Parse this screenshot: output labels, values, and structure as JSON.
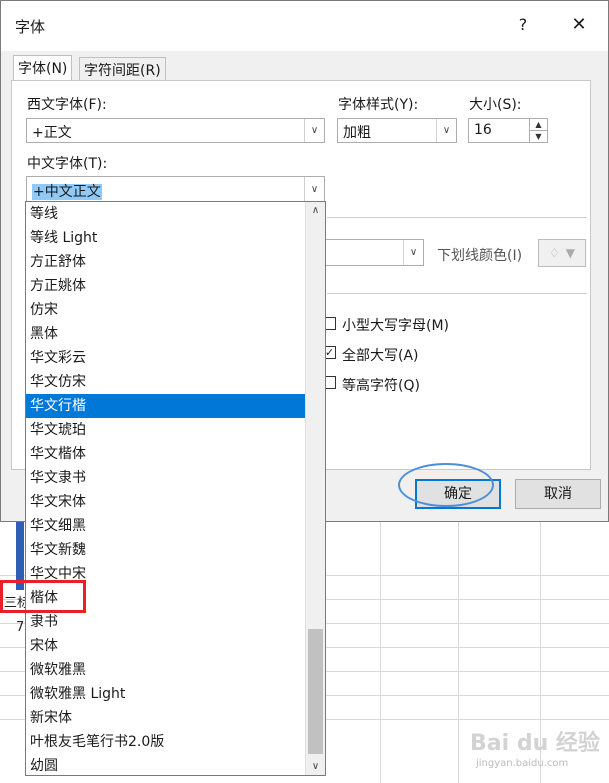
{
  "dialog": {
    "title": "字体",
    "help_label": "?",
    "close_label": "✕",
    "tabs": [
      {
        "label": "字体(N)"
      },
      {
        "label": "字符间距(R)"
      }
    ],
    "western_font_label": "西文字体(F):",
    "western_font_value": "+正文",
    "font_style_label": "字体样式(Y):",
    "font_style_value": "加粗",
    "size_label": "大小(S):",
    "size_value": "16",
    "chinese_font_label": "中文字体(T):",
    "chinese_font_value": "+中文正文",
    "underline_color_label": "下划线颜色(I)",
    "effects": [
      {
        "label": "小型大写字母(M)",
        "checked": false
      },
      {
        "label": "全部大写(A)",
        "checked": true
      },
      {
        "label": "等高字符(Q)",
        "checked": false
      }
    ],
    "ok_label": "确定",
    "cancel_label": "取消"
  },
  "dropdown": {
    "items": [
      "等线",
      "等线 Light",
      "方正舒体",
      "方正姚体",
      "仿宋",
      "黑体",
      "华文彩云",
      "华文仿宋",
      "华文行楷",
      "华文琥珀",
      "华文楷体",
      "华文隶书",
      "华文宋体",
      "华文细黑",
      "华文新魏",
      "华文中宋",
      "楷体",
      "隶书",
      "宋体",
      "微软雅黑",
      "微软雅黑 Light",
      "新宋体",
      "叶根友毛笔行书2.0版",
      "幼圆"
    ],
    "selected_index": 8
  },
  "sheet": {
    "partial_text_1": "三标",
    "partial_text_2": "7"
  },
  "watermark": {
    "brand": "Bai du 经验",
    "url": "jingyan.baidu.com"
  },
  "colors": {
    "accent": "#0078d7",
    "highlight": "#e8202a"
  }
}
